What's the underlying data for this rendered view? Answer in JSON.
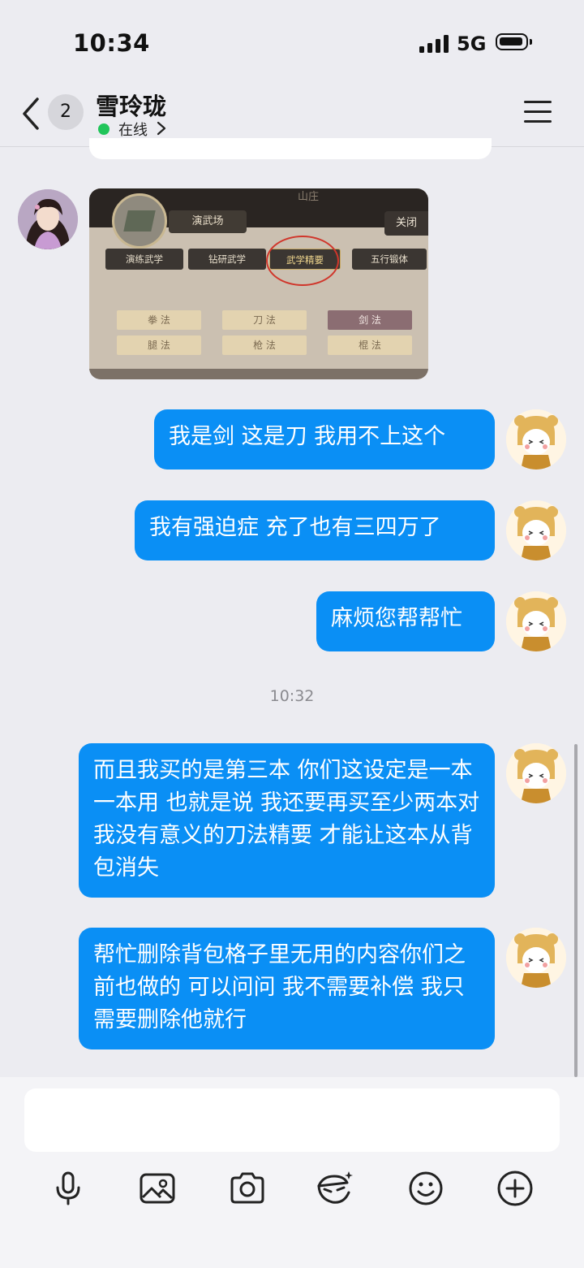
{
  "status_bar": {
    "time": "10:34",
    "network": "5G"
  },
  "header": {
    "unread_count": "2",
    "contact_name": "雪玲珑",
    "status": "在线"
  },
  "game_screenshot": {
    "top_title": "山庄",
    "tab": "演武场",
    "close": "关闭",
    "buttons": [
      "演练武学",
      "钻研武学",
      "武学精要",
      "五行锻体"
    ],
    "chips": [
      "拳 法",
      "刀 法",
      "剑 法",
      "腿 法",
      "枪 法",
      "棍 法"
    ]
  },
  "messages": [
    {
      "text": "我是剑 这是刀 我用不上这个"
    },
    {
      "text": "我有强迫症 充了也有三四万了"
    },
    {
      "text": "麻烦您帮帮忙"
    },
    {
      "text": "而且我买的是第三本 你们这设定是一本一本用 也就是说 我还要再买至少两本对我没有意义的刀法精要 才能让这本从背包消失"
    },
    {
      "text": "帮忙删除背包格子里无用的内容你们之前也做的 可以问问 我不需要补偿 我只需要删除他就行"
    }
  ],
  "timestamp": "10:32",
  "toolbar": [
    "microphone-icon",
    "image-icon",
    "camera-icon",
    "sticker-icon",
    "emoji-icon",
    "plus-icon"
  ],
  "colors": {
    "bubble": "#0a8ff5",
    "online": "#21c55a",
    "background": "#ececf1"
  }
}
